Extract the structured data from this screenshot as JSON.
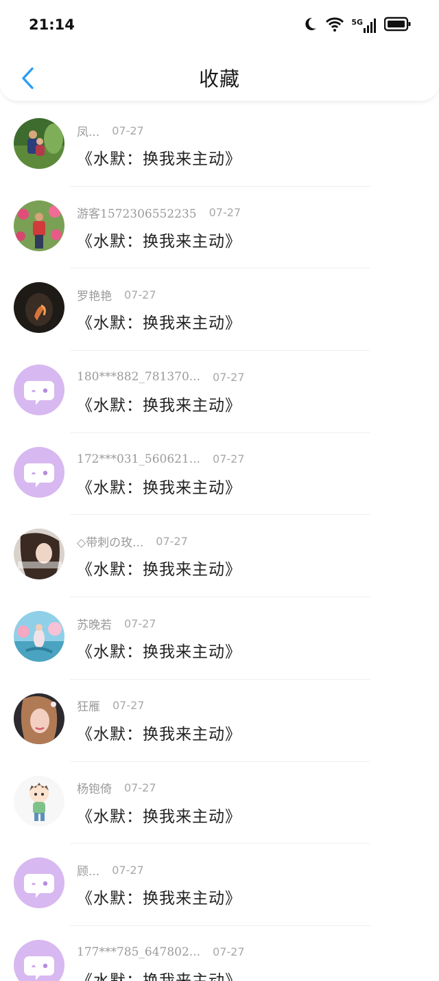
{
  "status_bar": {
    "time": "21:14",
    "network": "5G"
  },
  "header": {
    "title": "收藏"
  },
  "colors": {
    "accent": "#2a9df4",
    "default_avatar_bg": "#d7b8f0",
    "default_avatar_face": "#ffffff"
  },
  "favorites": [
    {
      "user": "凤...",
      "date": "07-27",
      "title": "《水默：换我来主动》",
      "avatar": "photo-family"
    },
    {
      "user": "游客1572306552235",
      "date": "07-27",
      "title": "《水默：换我来主动》",
      "avatar": "photo-garden"
    },
    {
      "user": "罗艳艳",
      "date": "07-27",
      "title": "《水默：换我来主动》",
      "avatar": "photo-dark"
    },
    {
      "user": "180***882_781370...",
      "date": "07-27",
      "title": "《水默：换我来主动》",
      "avatar": "default-chat"
    },
    {
      "user": "172***031_560621...",
      "date": "07-27",
      "title": "《水默：换我来主动》",
      "avatar": "default-chat"
    },
    {
      "user": "◇带刺の玫...",
      "date": "07-27",
      "title": "《水默：换我来主动》",
      "avatar": "photo-girl"
    },
    {
      "user": "苏晚若",
      "date": "07-27",
      "title": "《水默：换我来主动》",
      "avatar": "photo-fantasy"
    },
    {
      "user": "狂雁",
      "date": "07-27",
      "title": "《水默：换我来主动》",
      "avatar": "photo-woman"
    },
    {
      "user": "杨铇倚",
      "date": "07-27",
      "title": "《水默：换我来主动》",
      "avatar": "cartoon-boy"
    },
    {
      "user": "顾...",
      "date": "07-27",
      "title": "《水默：换我来主动》",
      "avatar": "default-chat"
    },
    {
      "user": "177***785_647802...",
      "date": "07-27",
      "title": "《水默：换我来主动》",
      "avatar": "default-chat"
    }
  ]
}
